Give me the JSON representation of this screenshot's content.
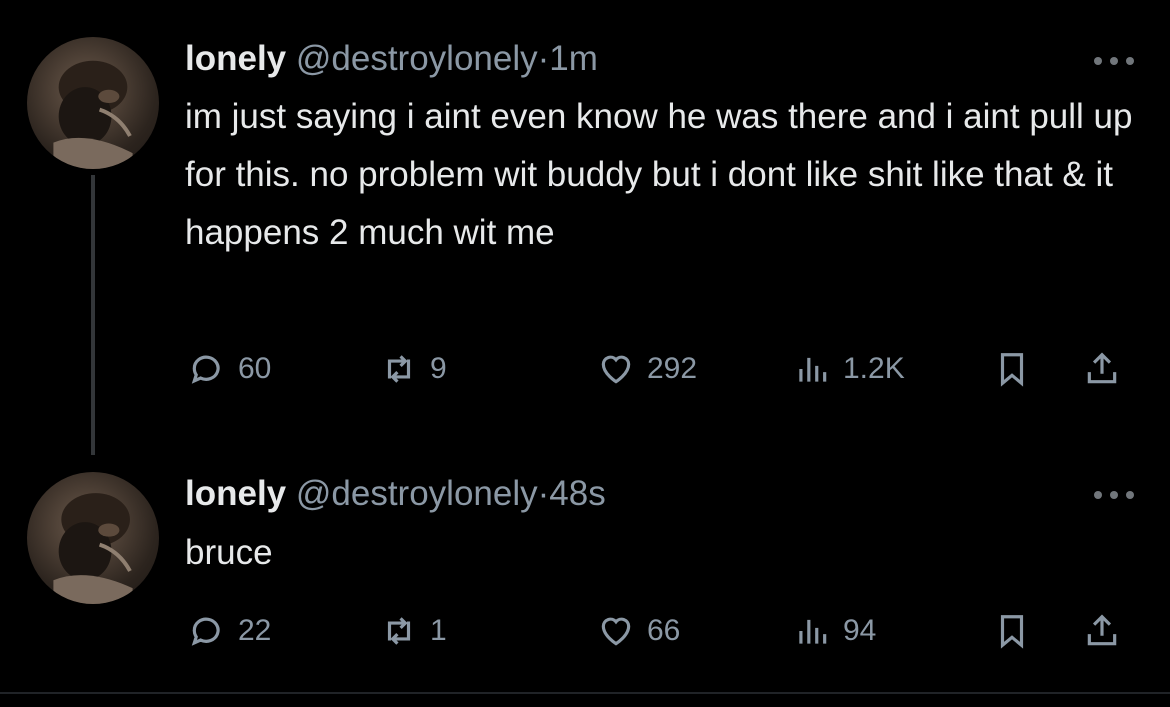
{
  "tweets": [
    {
      "name": "lonely",
      "handle": "@destroylonely",
      "separator": "·",
      "time": "1m",
      "text": "im just saying i aint even know he was there and i aint pull up for this. no problem wit buddy but i dont like shit like that & it happens 2 much wit me",
      "replies": "60",
      "retweets": "9",
      "likes": "292",
      "views": "1.2K"
    },
    {
      "name": "lonely",
      "handle": "@destroylonely",
      "separator": "·",
      "time": "48s",
      "text": "bruce",
      "replies": "22",
      "retweets": "1",
      "likes": "66",
      "views": "94"
    }
  ],
  "icons": {
    "reply": "reply-icon",
    "retweet": "retweet-icon",
    "like": "heart-icon",
    "views": "views-icon",
    "bookmark": "bookmark-icon",
    "share": "share-icon",
    "more": "more-icon"
  },
  "colors": {
    "background": "#000000",
    "text": "#e7e9ea",
    "secondary": "#8b98a5",
    "thread_line": "#333639"
  }
}
